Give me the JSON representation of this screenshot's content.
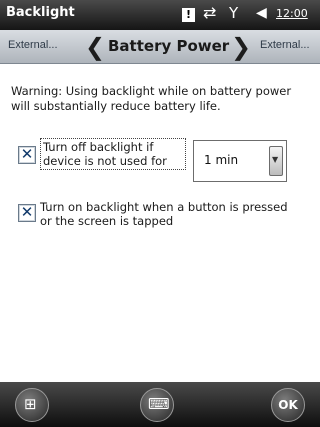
{
  "window": {
    "title": "Backlight",
    "clock": "12:00"
  },
  "icons": {
    "notification": "notification-icon",
    "sync": "sync-icon",
    "signal": "signal-icon",
    "volume": "volume-icon",
    "battery": "battery-icon"
  },
  "tabs": {
    "left_label": "External...",
    "current_label": "Battery Power",
    "right_label": "External..."
  },
  "warning_text": "Warning: Using backlight while on battery power will substantially reduce battery life.",
  "options": [
    {
      "label": "Turn off backlight if device is not used for",
      "checked": true
    },
    {
      "label": "Turn on backlight when a button is pressed or the screen is tapped",
      "checked": true
    }
  ],
  "timeout": {
    "selected": "1 min"
  },
  "bottom": {
    "ok_label": "OK"
  },
  "colors": {
    "title_bar": "#1f1f1f",
    "tab_bar": "#c3c9cf",
    "checkbox_mark": "#123a6b"
  }
}
